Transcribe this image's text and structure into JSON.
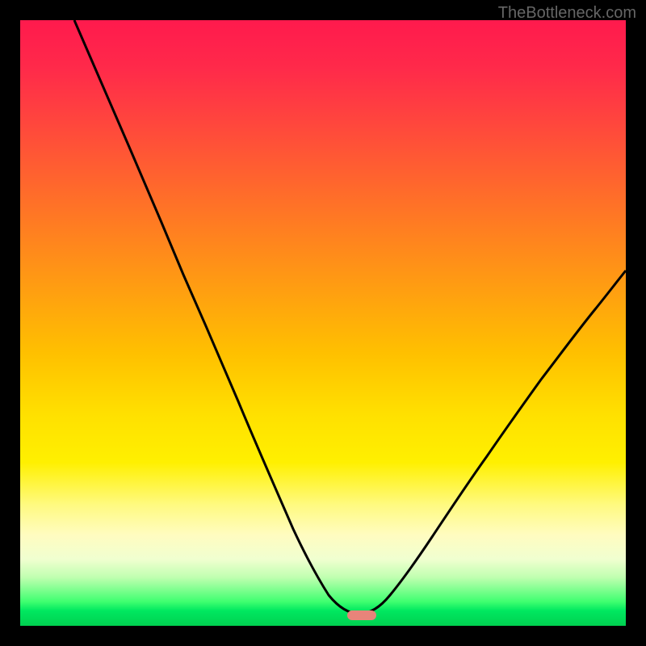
{
  "watermark": "TheBottleneck.com",
  "chart_data": {
    "type": "line",
    "title": "",
    "xlabel": "",
    "ylabel": "",
    "xlim": [
      0,
      100
    ],
    "ylim": [
      0,
      100
    ],
    "curve": {
      "description": "V-shaped bottleneck curve with minimum near x=57",
      "minimum_x": 57,
      "minimum_y": 2,
      "points": [
        {
          "x": 9,
          "y": 100
        },
        {
          "x": 12,
          "y": 93
        },
        {
          "x": 15,
          "y": 86
        },
        {
          "x": 18,
          "y": 79
        },
        {
          "x": 22,
          "y": 71
        },
        {
          "x": 26,
          "y": 63
        },
        {
          "x": 30,
          "y": 55
        },
        {
          "x": 34,
          "y": 47
        },
        {
          "x": 38,
          "y": 39
        },
        {
          "x": 42,
          "y": 31
        },
        {
          "x": 46,
          "y": 23
        },
        {
          "x": 49,
          "y": 16
        },
        {
          "x": 52,
          "y": 9
        },
        {
          "x": 55,
          "y": 4
        },
        {
          "x": 57,
          "y": 2
        },
        {
          "x": 60,
          "y": 3
        },
        {
          "x": 63,
          "y": 6
        },
        {
          "x": 67,
          "y": 11
        },
        {
          "x": 71,
          "y": 17
        },
        {
          "x": 76,
          "y": 24
        },
        {
          "x": 81,
          "y": 31
        },
        {
          "x": 86,
          "y": 38
        },
        {
          "x": 91,
          "y": 44
        },
        {
          "x": 96,
          "y": 50
        },
        {
          "x": 100,
          "y": 55
        }
      ]
    },
    "marker": {
      "x": 57,
      "y": 2,
      "color": "#e8847a"
    },
    "gradient_colors": {
      "top": "#ff1a4d",
      "middle": "#ffe000",
      "bottom": "#00d050"
    }
  }
}
